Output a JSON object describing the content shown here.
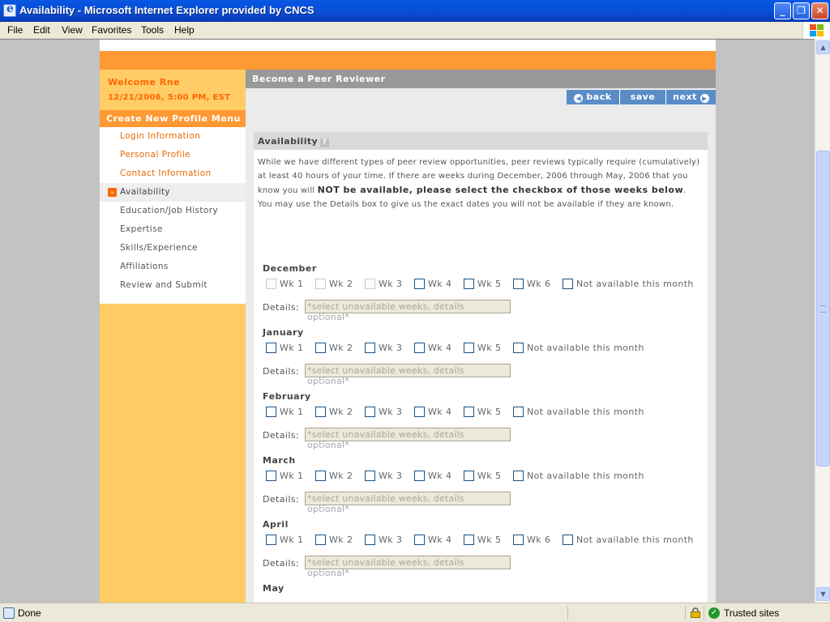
{
  "window": {
    "title": "Availability - Microsoft Internet Explorer provided by CNCS",
    "minimize": "_",
    "maximize": "❐",
    "close": "✕"
  },
  "menubar": [
    "File",
    "Edit",
    "View",
    "Favorites",
    "Tools",
    "Help"
  ],
  "sidebar": {
    "welcome": "Welcome Rne",
    "datetime": "12/21/2006, 5:00 PM, EST",
    "menu_title": "Create New Profile Menu",
    "items": [
      {
        "label": "Login Information"
      },
      {
        "label": "Personal Profile"
      },
      {
        "label": "Contact Information"
      },
      {
        "label": "Availability"
      },
      {
        "label": "Education/Job History"
      },
      {
        "label": "Expertise"
      },
      {
        "label": "Skills/Experience"
      },
      {
        "label": "Affiliations"
      },
      {
        "label": "Review and Submit"
      }
    ]
  },
  "content": {
    "header": "Become a Peer Reviewer",
    "back_label": "back",
    "save_label": "save",
    "next_label": "next"
  },
  "panel": {
    "title": "Availability",
    "help_icon": "?",
    "intro_1": "While we have different types of peer review opportunities, peer reviews typically require (cumulatively) at least 40 hours of your time. If there are weeks during December, 2006 through May, 2006 that you know you will ",
    "intro_bold": "NOT be available, please select the checkbox of those weeks below",
    "intro_2": ". You may use the Details box to give us the exact dates you will not be available if they are known.",
    "details_label": "Details:",
    "details_placeholder": "*select unavailable weeks, details optional*",
    "not_available_label": "Not available this month"
  },
  "months": [
    {
      "name": "December",
      "weeks": [
        "Wk 1",
        "Wk 2",
        "Wk 3",
        "Wk 4",
        "Wk 5",
        "Wk 6"
      ]
    },
    {
      "name": "January",
      "weeks": [
        "Wk 1",
        "Wk 2",
        "Wk 3",
        "Wk 4",
        "Wk 5"
      ]
    },
    {
      "name": "February",
      "weeks": [
        "Wk 1",
        "Wk 2",
        "Wk 3",
        "Wk 4",
        "Wk 5"
      ]
    },
    {
      "name": "March",
      "weeks": [
        "Wk 1",
        "Wk 2",
        "Wk 3",
        "Wk 4",
        "Wk 5"
      ]
    },
    {
      "name": "April",
      "weeks": [
        "Wk 1",
        "Wk 2",
        "Wk 3",
        "Wk 4",
        "Wk 5",
        "Wk 6"
      ]
    },
    {
      "name": "May",
      "weeks": []
    }
  ],
  "statusbar": {
    "status": "Done",
    "zone": "Trusted sites"
  },
  "colors": {
    "accent_orange": "#ff9933",
    "sidebar_bg": "#ffcc66",
    "link_orange": "#e86a00",
    "button_blue": "#5a8dc8"
  }
}
